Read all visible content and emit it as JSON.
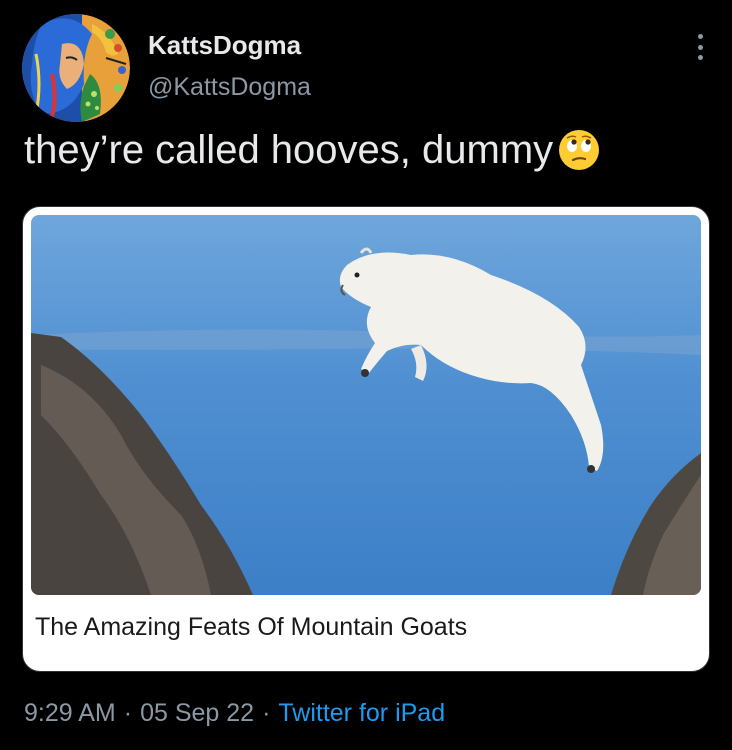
{
  "author": {
    "display_name": "KattsDogma",
    "handle": "@KattsDogma",
    "avatar": "avatar-portrait-icon"
  },
  "tweet": {
    "text": "they’re called hooves, dummy",
    "emoji": "face-with-rolling-eyes-icon"
  },
  "link_card": {
    "image": "mountain-goat-leaping-photo",
    "title": "The Amazing Feats Of Mountain Goats"
  },
  "meta": {
    "time": "9:29 AM",
    "separator": "·",
    "date": "05 Sep 22",
    "source": "Twitter for iPad"
  },
  "colors": {
    "background": "#000000",
    "primary_text": "#e7e9ea",
    "secondary_text": "#8b98a5",
    "link": "#1d9bf0"
  }
}
